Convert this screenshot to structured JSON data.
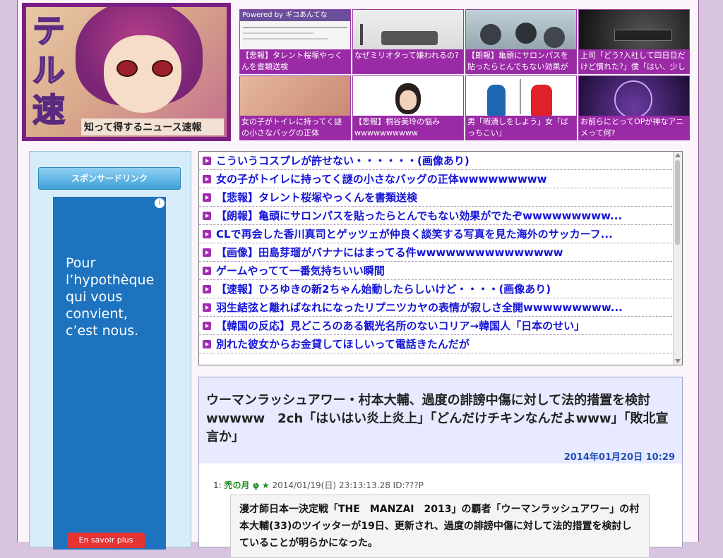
{
  "logo": {
    "vertical_text": "テル速",
    "tagline": "知って得するニュース速報"
  },
  "thumbs": [
    {
      "caption": "【悲報】タレント桜塚やっくんを書類送検",
      "banner": "Powered by ギコあんてな"
    },
    {
      "caption": "なぜミリオタって嫌われるの?"
    },
    {
      "caption": "【朗報】亀頭にサロンパスを貼ったらとんでもない効果がでた"
    },
    {
      "caption": "上司「どう?入社して四日目だけど慣れた?」僕「はい、少しは"
    },
    {
      "caption": "女の子がトイレに持ってく謎の小さなバッグの正体wwwwwwww"
    },
    {
      "caption": "【悲報】桐谷美玲の悩みwwwwwwwwww"
    },
    {
      "caption": "男「暇潰しをしよう」女「ばっちこい」"
    },
    {
      "caption": "お前らにとってOPが神なアニメって何?"
    }
  ],
  "sidebar": {
    "sponsor_label": "スポンサードリンク",
    "ad_text": "Pour l’hypothèque qui vous convient, c’est nous.",
    "ad_button": "En savoir plus",
    "ad_info": "i"
  },
  "links": [
    "こういうコスプレが許せない・・・・・・(画像あり)",
    "女の子がトイレに持ってく謎の小さなバッグの正体wwwwwwwww",
    "【悲報】タレント桜塚やっくんを書類送検",
    "【朗報】亀頭にサロンパスを貼ったらとんでもない効果がでたぞwwwwwwwww...",
    "CLで再会した香川真司とゲッツェが仲良く談笑する写真を見た海外のサッカーフ...",
    "【画像】田島芽瑠がバナナにはまってる件wwwwwwwwwwwwwww",
    "ゲームやってて一番気持ちいい瞬間",
    "【速報】ひろゆきの新2ちゃん始動したらしいけど・・・・(画像あり)",
    "羽生結弦と離ればなれになったリプニツカヤの表情が寂しさ全開wwwwwwwww...",
    "【韓国の反応】見どころのある観光名所のないコリア→韓国人「日本のせい」",
    "別れた彼女からお金貸してほしいって電話きたんだが"
  ],
  "article": {
    "title": "ウーマンラッシュアワー・村本大輔、過度の誹謗中傷に対して法的措置を検討wwwww　2ch「はいはい炎上炎上」「どんだけチキンなんだよwww」「敗北宣言か」",
    "date": "2014年01月20日 10:29",
    "res_num": "1:",
    "res_name": "禿の月 φ",
    "res_star": "★",
    "res_meta": "2014/01/19(日) 23:13:13.28 ID:???P",
    "body": "漫才師日本一決定戦「THE　MANZAI　2013」の覇者「ウーマンラッシュアワー」の村本大輔(33)のツイッターが19日、更新され、過度の誹謗中傷に対して法的措置を検討していることが明らかになった。"
  }
}
